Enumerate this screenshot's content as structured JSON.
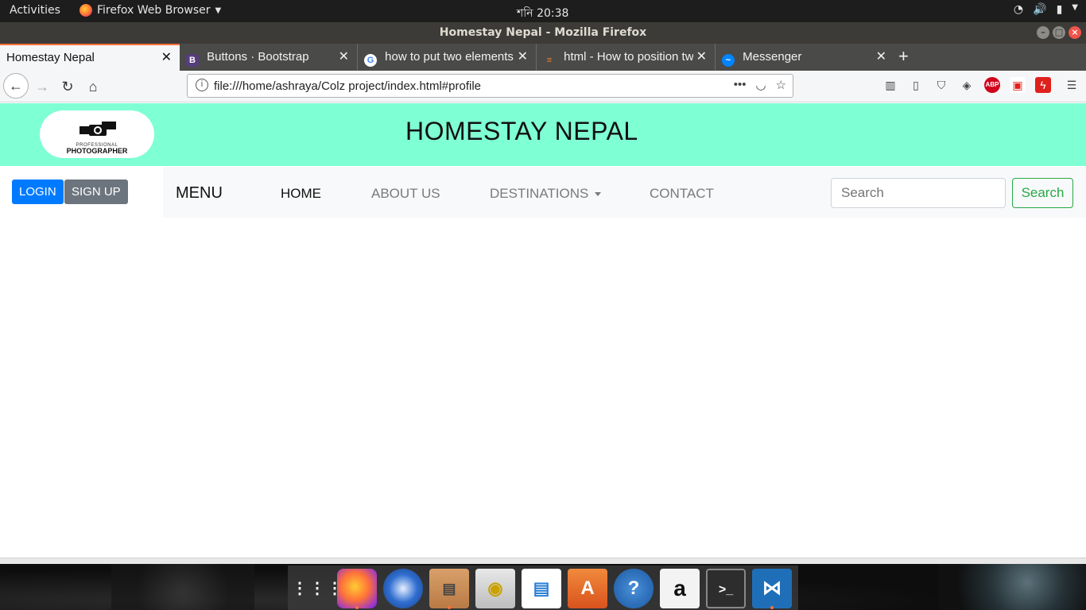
{
  "system": {
    "activities": "Activities",
    "app_menu": "Firefox Web Browser",
    "clock": "শনি 20:38"
  },
  "window": {
    "title": "Homestay Nepal - Mozilla Firefox"
  },
  "tabs": [
    {
      "label": "Homestay Nepal",
      "active": true
    },
    {
      "label": "Buttons · Bootstrap",
      "active": false
    },
    {
      "label": "how to put two elements",
      "active": false
    },
    {
      "label": "html - How to position tw",
      "active": false
    },
    {
      "label": "Messenger",
      "active": false
    }
  ],
  "toolbar": {
    "url": "file:///home/ashraya/Colz project/index.html#profile"
  },
  "page": {
    "logo": {
      "line1": "PROFESSIONAL",
      "line2": "PHOTOGRAPHER"
    },
    "site_title": "HOMESTAY NEPAL",
    "auth": {
      "login": "LOGIN",
      "signup": "SIGN UP"
    },
    "nav": {
      "menu_title": "MENU",
      "home": "HOME",
      "about": "ABOUT US",
      "destinations": "DESTINATIONS",
      "contact": "CONTACT",
      "search_placeholder": "Search",
      "search_button": "Search"
    }
  },
  "colors": {
    "header_bg": "#7fffd4",
    "login_btn": "#007bff",
    "signup_btn": "#6c757d",
    "search_btn": "#28a745",
    "tab_accent": "#ff7139"
  },
  "dock": {
    "apps": [
      "app-grid-icon",
      "firefox-icon",
      "thunderbird-icon",
      "files-icon",
      "rhythmbox-icon",
      "libreoffice-writer-icon",
      "software-center-icon",
      "help-icon",
      "amazon-icon",
      "terminal-icon",
      "vscode-icon"
    ]
  }
}
